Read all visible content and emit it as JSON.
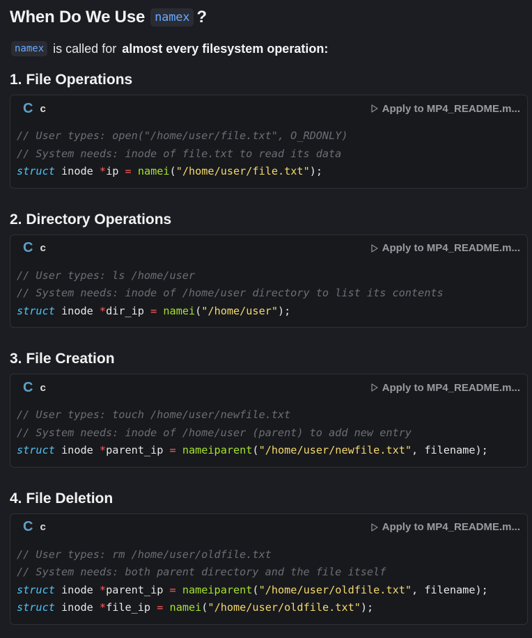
{
  "heading": {
    "prefix": "When Do We Use",
    "code": "namex",
    "suffix": "?"
  },
  "intro": {
    "code": "namex",
    "text": "is called for",
    "bold": "almost every filesystem operation:"
  },
  "apply_label": "Apply to MP4_README.m...",
  "sections": [
    {
      "title": "1. File Operations",
      "lang": "c",
      "comments": [
        "// User types: open(\"/home/user/file.txt\", O_RDONLY)",
        "// System needs: inode of file.txt to read its data"
      ],
      "code_lines": [
        {
          "kw": "struct",
          "ty": "inode",
          "star": "*",
          "var": "ip",
          "eq": "=",
          "fn": "namei",
          "open": "(",
          "str": "\"/home/user/file.txt\"",
          "rest": ");"
        }
      ]
    },
    {
      "title": "2. Directory Operations",
      "lang": "c",
      "comments": [
        "// User types: ls /home/user",
        "// System needs: inode of /home/user directory to list its contents"
      ],
      "code_lines": [
        {
          "kw": "struct",
          "ty": "inode",
          "star": "*",
          "var": "dir_ip",
          "eq": "=",
          "fn": "namei",
          "open": "(",
          "str": "\"/home/user\"",
          "rest": ");"
        }
      ]
    },
    {
      "title": "3. File Creation",
      "lang": "c",
      "comments": [
        "// User types: touch /home/user/newfile.txt",
        "// System needs: inode of /home/user (parent) to add new entry"
      ],
      "code_lines": [
        {
          "kw": "struct",
          "ty": "inode",
          "star": "*",
          "var": "parent_ip",
          "eq": "=",
          "fn": "nameiparent",
          "open": "(",
          "str": "\"/home/user/newfile.txt\"",
          "rest": ", filename);"
        }
      ]
    },
    {
      "title": "4. File Deletion",
      "lang": "c",
      "comments": [
        "// User types: rm /home/user/oldfile.txt",
        "// System needs: both parent directory and the file itself"
      ],
      "code_lines": [
        {
          "kw": "struct",
          "ty": "inode",
          "star": "*",
          "var": "parent_ip",
          "eq": "=",
          "fn": "nameiparent",
          "open": "(",
          "str": "\"/home/user/oldfile.txt\"",
          "rest": ", filename);"
        },
        {
          "kw": "struct",
          "ty": "inode",
          "star": "*",
          "var": "file_ip",
          "eq": "=",
          "fn": "namei",
          "open": "(",
          "str": "\"/home/user/oldfile.txt\"",
          "rest": ");"
        }
      ]
    }
  ]
}
